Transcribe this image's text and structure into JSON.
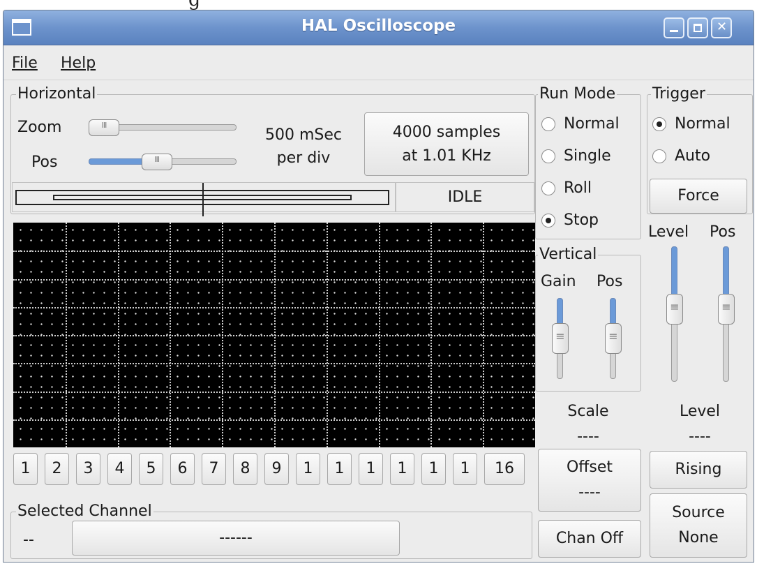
{
  "window": {
    "title": "HAL Oscilloscope"
  },
  "menu": [
    "File",
    "Help"
  ],
  "horizontal": {
    "label": "Horizontal",
    "zoom_label": "Zoom",
    "pos_label": "Pos",
    "zoom_value": 0.0,
    "pos_value": 0.45,
    "rate_line1": "500 mSec",
    "rate_line2": "per div",
    "samples_line1": "4000 samples",
    "samples_line2": "at 1.01 KHz",
    "status": "IDLE"
  },
  "run_mode": {
    "label": "Run Mode",
    "options": [
      "Normal",
      "Single",
      "Roll",
      "Stop"
    ],
    "selected": "Stop"
  },
  "trigger": {
    "label": "Trigger",
    "options": [
      "Normal",
      "Auto"
    ],
    "selected": "Normal",
    "force_label": "Force",
    "level_label": "Level",
    "pos_label": "Pos",
    "level_value": 0.55,
    "pos_value": 0.55,
    "level_caption": "Level",
    "level_readout": "----",
    "edge_button": "Rising",
    "source_line1": "Source",
    "source_line2": "None"
  },
  "vertical": {
    "label": "Vertical",
    "gain_label": "Gain",
    "pos_label": "Pos",
    "gain_value": 0.5,
    "pos_value": 0.5,
    "scale_label": "Scale",
    "scale_value": "----",
    "offset_label": "Offset",
    "offset_value": "----",
    "chan_off": "Chan Off"
  },
  "channels": [
    "1",
    "2",
    "3",
    "4",
    "5",
    "6",
    "7",
    "8",
    "9",
    "1",
    "1",
    "1",
    "1",
    "1",
    "1",
    "16"
  ],
  "selected_channel": {
    "label": "Selected Channel",
    "number": "--",
    "name": "------"
  },
  "colors": {
    "titlebar": "#6d93cc",
    "slider_fill": "#6b9ad8",
    "scope_bg": "#000000"
  }
}
